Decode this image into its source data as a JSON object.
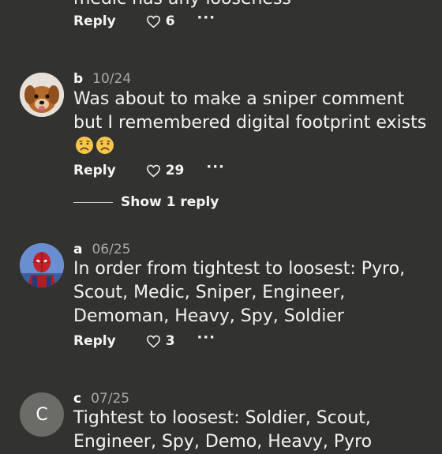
{
  "comments": [
    {
      "text_fragment": "medic has any looseness",
      "actions": {
        "reply_label": "Reply",
        "like_count": "6",
        "more": "···"
      }
    },
    {
      "username": "b",
      "date": "10/24",
      "avatar_icon": "dog-avatar",
      "text": "Was about to make a sniper comment but I remembered digital footprint exists",
      "emoji": [
        "worried-face-emoji",
        "worried-face-emoji"
      ],
      "actions": {
        "reply_label": "Reply",
        "like_count": "29",
        "more": "···"
      },
      "show_replies_label": "Show 1 reply"
    },
    {
      "username": "a",
      "date": "06/25",
      "avatar_icon": "spiderman-avatar",
      "text": "In order from tightest to loosest: Pyro, Scout, Medic, Sniper, Engineer, Demoman, Heavy, Spy, Soldier",
      "actions": {
        "reply_label": "Reply",
        "like_count": "3",
        "more": "···"
      }
    },
    {
      "username": "c",
      "date": "07/25",
      "avatar_letter": "C",
      "text": "Tightest to loosest: Soldier, Scout, Engineer, Spy, Demo, Heavy, Pyro"
    }
  ],
  "colors": {
    "background": "#323230",
    "text": "#ffffff",
    "date": "#a9a9a4",
    "letter_avatar_bg": "#6b6b68"
  }
}
